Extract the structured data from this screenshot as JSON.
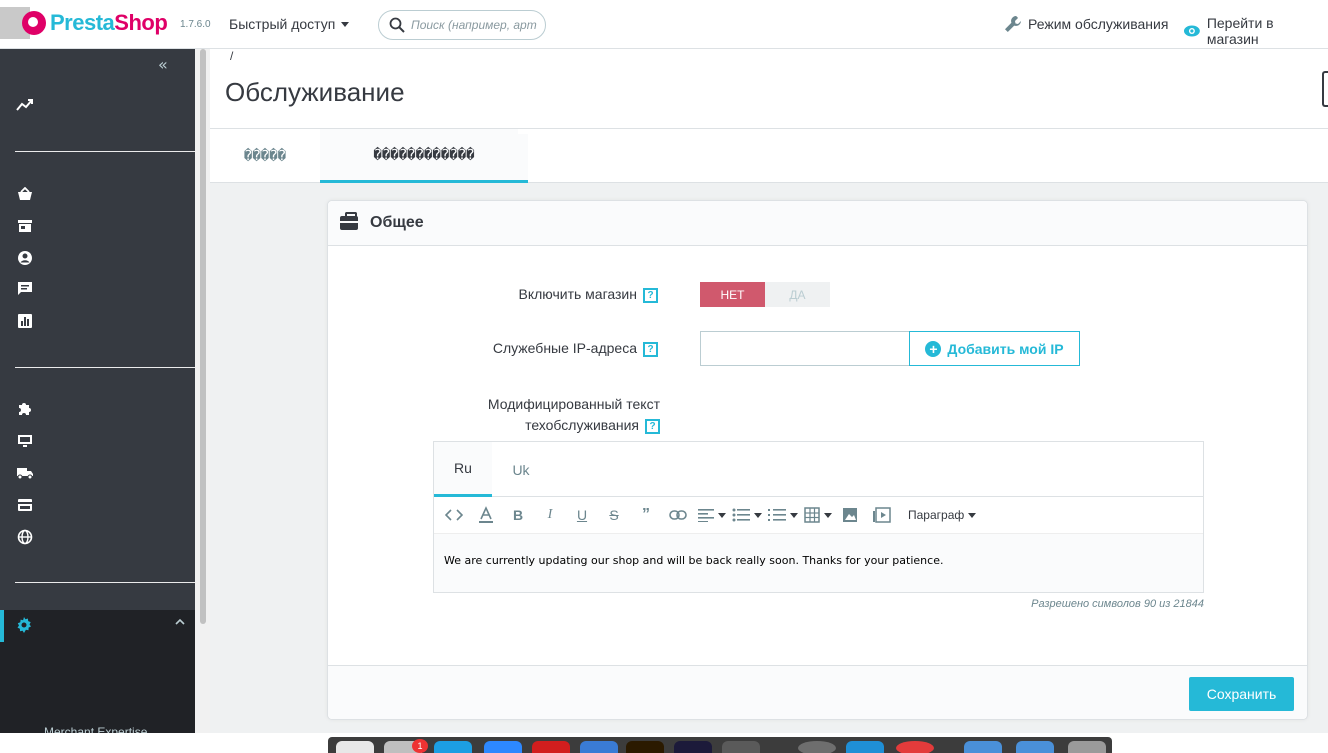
{
  "header": {
    "brand_presta": "Presta",
    "brand_shop": "Shop",
    "version": "1.7.6.0",
    "quick_access": "Быстрый доступ",
    "search_placeholder": "Поиск (например, арт",
    "maintenance_mode": "Режим обслуживания",
    "view_shop": "Перейти в магазин"
  },
  "sidebar": {
    "collapse_glyph": "«",
    "icons": [
      "trending-up-icon",
      "basket-icon",
      "store-icon",
      "customer-icon",
      "message-icon",
      "stats-icon",
      "puzzle-icon",
      "monitor-icon",
      "truck-icon",
      "credit-card-icon",
      "globe-icon",
      "gear-icon"
    ],
    "footer_text": "Merchant Expertise"
  },
  "page": {
    "breadcrumb": "/",
    "title": "Обслуживание"
  },
  "tabs": [
    {
      "label": "�����"
    },
    {
      "label": "������������"
    }
  ],
  "card": {
    "title": "Общее",
    "enable_shop_label": "Включить магазин",
    "switch_no": "НЕТ",
    "switch_yes": "ДА",
    "switch_selected": "НЕТ",
    "ip_label": "Служебные IP-адреса",
    "ip_value": "",
    "add_ip_button": "Добавить мой IP",
    "custom_text_label_line1": "Модифицированный текст",
    "custom_text_label_line2": "техобслуживания",
    "help_glyph": "?",
    "languages": [
      "Ru",
      "Uk"
    ],
    "active_language": "Ru",
    "paragraph_select": "Параграф",
    "editor_text": "We are currently updating our shop and will be back really soon. Thanks for your patience.",
    "char_counter": "Разрешено символов 90 из 21844",
    "save_button": "Сохранить"
  },
  "colors": {
    "accent": "#25b9d7",
    "brand_pink": "#df0067",
    "sidebar": "#363a41",
    "switch_no": "#d0596d"
  },
  "dock": {
    "badge_count": "1"
  }
}
